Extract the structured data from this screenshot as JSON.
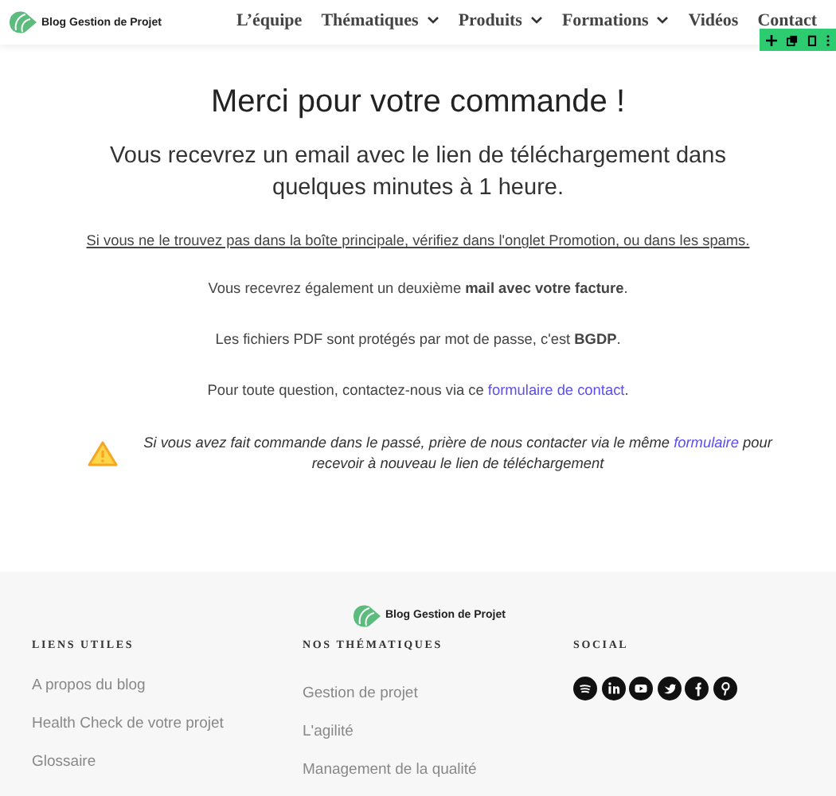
{
  "header": {
    "logo_text": "Blog Gestion de Projet",
    "nav": [
      {
        "label": "L’équipe",
        "has_menu": false
      },
      {
        "label": "Thématiques",
        "has_menu": true
      },
      {
        "label": "Produits",
        "has_menu": true
      },
      {
        "label": "Formations",
        "has_menu": true
      },
      {
        "label": "Vidéos",
        "has_menu": false
      },
      {
        "label": "Contact",
        "has_menu": false
      }
    ]
  },
  "main": {
    "title": "Merci pour votre commande !",
    "subtitle": "Vous recevrez un email avec le lien de téléchargement dans quelques minutes à 1 heure.",
    "notice": "Si vous ne le trouvez pas dans la boîte principale, vérifiez dans l'onglet Promotion, ou dans les spams.",
    "invoice_note": "Vous recevrez également un deuxième **mail avec votre facture**.",
    "password_note": "Les fichiers PDF sont protégés par mot de passe, c'est **BGDP**.",
    "contact_note": {
      "before": "Pour toute question, contactez-nous via ce ",
      "link": "formulaire de contact",
      "after": "."
    },
    "warning": {
      "before": "Si vous avez fait commande dans le passé, prière de nous contacter via le même ",
      "link": "formulaire",
      "after": " pour recevoir à nouveau le lien de téléchargement"
    }
  },
  "footer": {
    "logo_text": "Blog Gestion de Projet",
    "columns": [
      {
        "heading": "LIENS UTILES",
        "kind": "links",
        "links": [
          "A propos du blog",
          "Health Check de votre projet",
          "Glossaire"
        ]
      },
      {
        "heading": "NOS THÉMATIQUES",
        "kind": "links",
        "links": [
          "Gestion de projet",
          "L'agilité",
          "Management de la qualité"
        ]
      },
      {
        "heading": "SOCIAL",
        "kind": "social"
      }
    ]
  }
}
